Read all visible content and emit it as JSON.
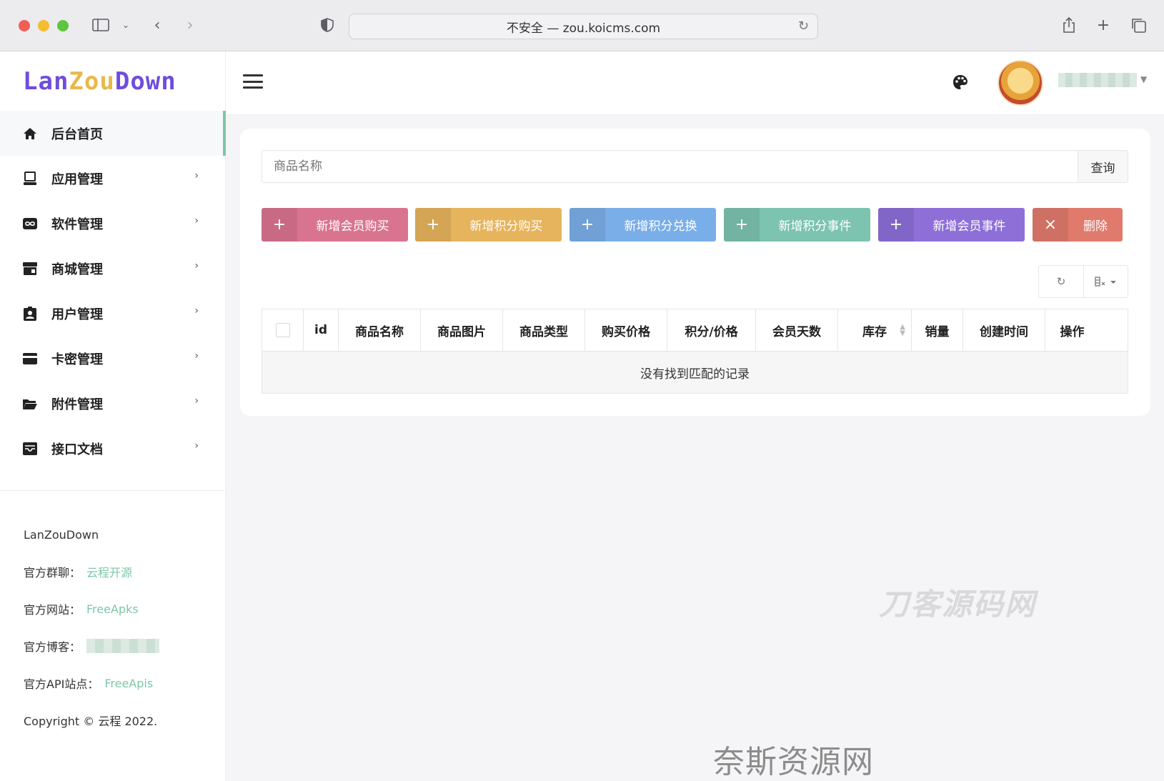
{
  "browser": {
    "url": "不安全 — zou.koicms.com"
  },
  "logo": {
    "part1": "Lan",
    "part2": "Zou",
    "part3": "Down"
  },
  "sidebar": {
    "items": [
      {
        "label": "后台首页",
        "icon": "home-icon",
        "active": true
      },
      {
        "label": "应用管理",
        "icon": "monitor-icon"
      },
      {
        "label": "软件管理",
        "icon": "infinity-icon"
      },
      {
        "label": "商城管理",
        "icon": "store-icon"
      },
      {
        "label": "用户管理",
        "icon": "user-badge-icon"
      },
      {
        "label": "卡密管理",
        "icon": "card-icon"
      },
      {
        "label": "附件管理",
        "icon": "folder-icon"
      },
      {
        "label": "接口文档",
        "icon": "inbox-icon"
      }
    ],
    "footer": {
      "brand": "LanZouDown",
      "group_label": "官方群聊：",
      "group_link": "云程开源",
      "site_label": "官方网站：",
      "site_link": "FreeApks",
      "blog_label": "官方博客：",
      "api_label": "官方API站点：",
      "api_link": "FreeApis",
      "copyright": "Copyright © 云程 2022."
    }
  },
  "search": {
    "placeholder": "商品名称",
    "button": "查询"
  },
  "actions": [
    {
      "label": "新增会员购买",
      "icon": "+",
      "color": "#d9748f"
    },
    {
      "label": "新增积分购买",
      "icon": "+",
      "color": "#e6b45c"
    },
    {
      "label": "新增积分兑换",
      "icon": "+",
      "color": "#7aaee8"
    },
    {
      "label": "新增积分事件",
      "icon": "+",
      "color": "#7cc3b0"
    },
    {
      "label": "新增会员事件",
      "icon": "+",
      "color": "#8e6fd8"
    },
    {
      "label": "删除",
      "icon": "×",
      "color": "#e07a6c"
    }
  ],
  "table": {
    "columns": [
      "id",
      "商品名称",
      "商品图片",
      "商品类型",
      "购买价格",
      "积分/价格",
      "会员天数",
      "库存",
      "销量",
      "创建时间",
      "操作"
    ],
    "empty_message": "没有找到匹配的记录"
  },
  "watermarks": {
    "center": "刀客源码网",
    "bottom": "奈斯资源网www.nicezyw.com"
  }
}
